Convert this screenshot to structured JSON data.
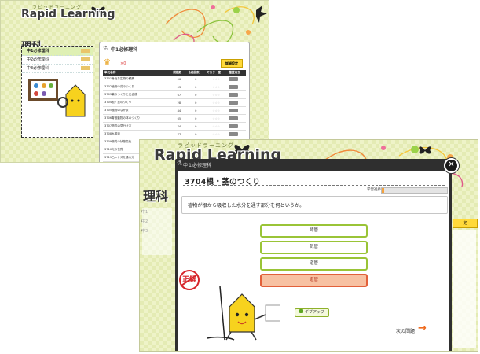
{
  "back": {
    "logo_sub": "ラピッドラーニング",
    "logo_main": "Rapid Learning",
    "subject_title": "理科",
    "left_menu": [
      {
        "label": "中1必修理科",
        "tag": "",
        "active": true
      },
      {
        "label": "中2必修理科",
        "tag": ""
      },
      {
        "label": "中3必修理科",
        "tag": ""
      }
    ],
    "main_title": "中1必修理科",
    "crown_count": "×0",
    "detail_button": "詳細設定",
    "table_headers": [
      "単元名称",
      "問題数",
      "合格回数",
      "マスター度",
      "履歴消去"
    ],
    "rows": [
      {
        "name": "3701身近な生物の観察",
        "count": "56",
        "passed": "0",
        "stars": "☆☆☆"
      },
      {
        "name": "3702植物の花のつくり",
        "count": "53",
        "passed": "0",
        "stars": "☆☆☆"
      },
      {
        "name": "3703葉のつくりと光合成",
        "count": "67",
        "passed": "0",
        "stars": "☆☆☆"
      },
      {
        "name": "3704根・茎のつくり",
        "count": "28",
        "passed": "0",
        "stars": "☆☆☆"
      },
      {
        "name": "3705植物のなかま",
        "count": "44",
        "passed": "0",
        "stars": "☆☆☆"
      },
      {
        "name": "3706脊椎動物の体のつくり",
        "count": "65",
        "passed": "0",
        "stars": "☆☆☆"
      },
      {
        "name": "3707物質の見分け方",
        "count": "74",
        "passed": "0",
        "stars": "☆☆☆"
      },
      {
        "name": "3708水溶液",
        "count": "77",
        "passed": "0",
        "stars": "☆☆☆"
      },
      {
        "name": "3709物質の状態変化",
        "count": "",
        "passed": "",
        "stars": ""
      },
      {
        "name": "3710光の性質",
        "count": "",
        "passed": "",
        "stars": ""
      },
      {
        "name": "3711凸レンズを通る光",
        "count": "",
        "passed": "",
        "stars": ""
      }
    ]
  },
  "front": {
    "logo_sub": "ラピッドラーニング",
    "logo_main": "Rapid Learning",
    "subject_title": "理科",
    "tab_label": "中１必修理科",
    "question_title": "3704根・茎のつくり",
    "progress_label": "学習進捗：",
    "progress_fraction": 0.04,
    "question": "植物が根から吸収した水分を通す部分を何というか。",
    "choices": [
      {
        "label": "師管",
        "selected": false
      },
      {
        "label": "気管",
        "selected": false
      },
      {
        "label": "道管",
        "selected": false
      },
      {
        "label": "道管",
        "selected": true
      }
    ],
    "skip_label": "ギブアップ",
    "next_label": "次の問題",
    "correct_stamp": "正解",
    "close_glyph": "✕",
    "side_items": [
      "中1",
      "中2",
      "中3"
    ],
    "side_right": "定"
  },
  "colors": {
    "accent_green": "#9ac437",
    "selected_red": "#e2603a",
    "progress_orange": "#f4a23e"
  }
}
